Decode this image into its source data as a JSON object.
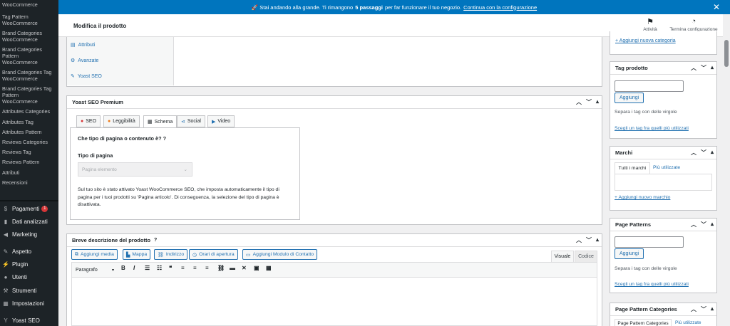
{
  "sidebar": {
    "sub_items": [
      "WooCommerce",
      "Tag Pattern WooCommerce",
      "Brand Categories WooCommerce",
      "Brand Categories Pattern WooCommerce",
      "Brand Categories Tag WooCommerce",
      "Brand Categories Tag Pattern WooCommerce",
      "Attributes Categories",
      "Attributes Tag",
      "Attributes Pattern",
      "Reviews Categories",
      "Reviews Tag",
      "Reviews Pattern",
      "Attributi",
      "Recensioni"
    ],
    "menu": {
      "pagamenti": "Pagamenti",
      "pagamenti_badge": "1",
      "dati": "Dati analizzati",
      "marketing": "Marketing",
      "aspetto": "Aspetto",
      "plugin": "Plugin",
      "utenti": "Utenti",
      "strumenti": "Strumenti",
      "impostazioni": "Impostazioni",
      "yoast": "Yoast SEO"
    }
  },
  "banner": {
    "before": "🚀 Stai andando alla grande. Ti rimangono",
    "bold": "5 passaggi",
    "after": "per far funzionare il tuo negozio.",
    "link": "Continua con la configurazione"
  },
  "header": {
    "title": "Modifica il prodotto",
    "activity": "Attività",
    "finish": "Termina configurazione"
  },
  "product_data": {
    "tabs": [
      "Attributi",
      "Avanzate",
      "Yoast SEO"
    ]
  },
  "yoast": {
    "title": "Yoast SEO Premium",
    "tabs": [
      "SEO",
      "Leggibilità",
      "Schema",
      "Social",
      "Video"
    ],
    "question": "Che tipo di pagina o contenuto è?",
    "page_type_label": "Tipo di pagina",
    "page_type_value": "Pagina elemento",
    "notice": "Sul tuo sito è stato attivato Yoast WooCommerce SEO, che imposta automaticamente il tipo di pagina per i tuoi prodotti su 'Pagina articolo'. Di conseguenza, la selezione del tipo di pagina è disattivata."
  },
  "short_desc": {
    "title": "Breve descrizione del prodotto",
    "buttons": [
      "Aggiungi media",
      "Mappa",
      "Indirizzo",
      "Orari di apertura",
      "Aggiungi Modulo di Contatto"
    ],
    "visual": "Visuale",
    "code": "Codice",
    "format": "Paragrafo"
  },
  "right": {
    "add_category": "+ Aggiungi nuova categoria",
    "tag_title": "Tag prodotto",
    "add_btn": "Aggiungi",
    "separate": "Separa i tag con delle virgole",
    "choose": "Scegli un tag fra quelli più utilizzati",
    "brand_title": "Marchi",
    "brand_tab_all": "Tutti i marchi",
    "brand_tab_most": "Più utilizzate",
    "add_brand": "+ Aggiungi nuovo marchio",
    "patterns_title": "Page Patterns",
    "pattern_cat_title": "Page Pattern Categories",
    "pattern_cat_tab": "Page Pattern Categories",
    "pattern_cat_most": "Più utilizzate"
  }
}
